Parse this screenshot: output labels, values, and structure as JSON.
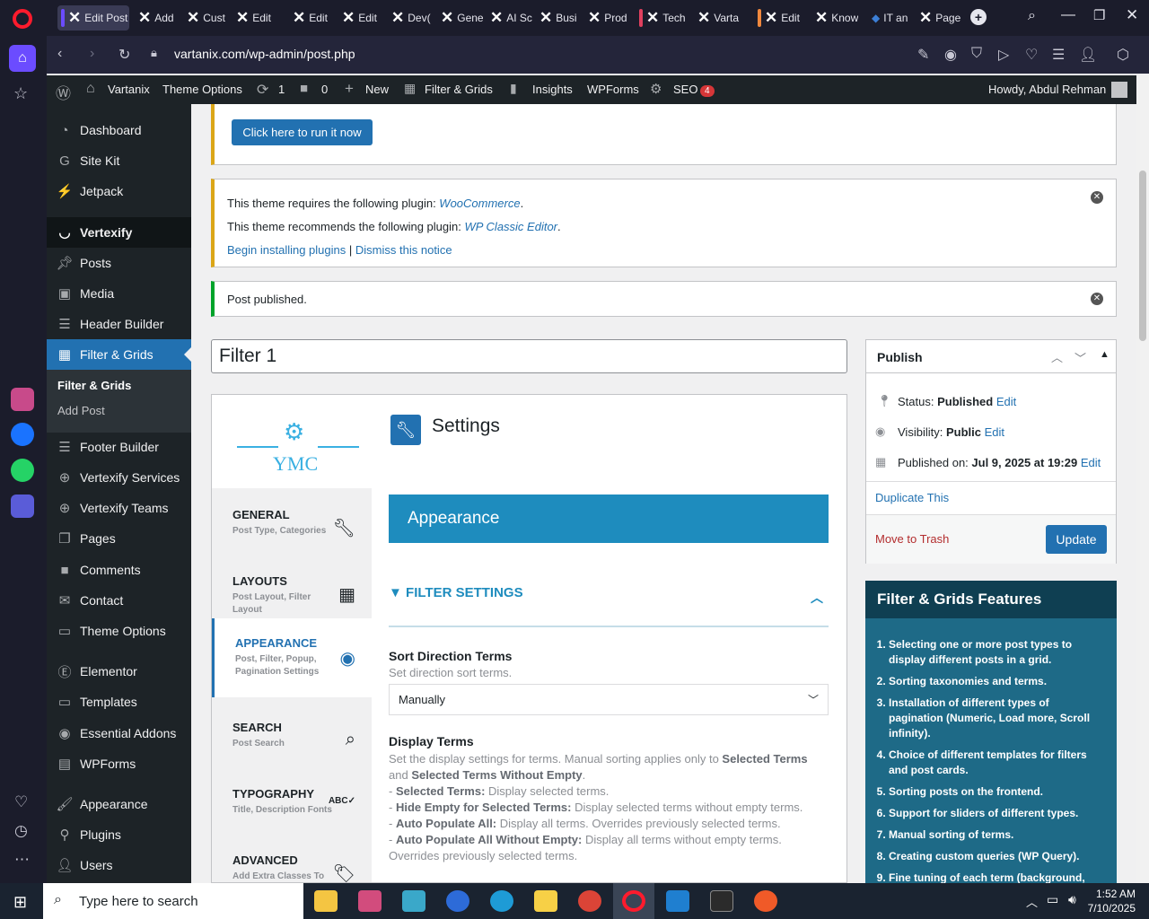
{
  "browser": {
    "tabs": [
      "Edit Post",
      "Add",
      "Cust",
      "Edit",
      "Edit",
      "Edit",
      "Dev(",
      "Gene",
      "AI Sc",
      "Busi",
      "Prod",
      "Tech",
      "Varta",
      "Edit",
      "Know",
      "IT an",
      "Page"
    ],
    "url": "vartanix.com/wp-admin/post.php",
    "accent": "#6b4cff"
  },
  "adminbar": {
    "site": "Vartanix",
    "theme_options": "Theme Options",
    "updates": "1",
    "comments": "0",
    "new": "New",
    "filter_grids": "Filter & Grids",
    "insights": "Insights",
    "wpforms": "WPForms",
    "seo": "SEO",
    "seo_badge": "4",
    "howdy": "Howdy, Abdul Rehman"
  },
  "sidebar": {
    "items": [
      {
        "label": "Dashboard",
        "icon": "dashboard-icon"
      },
      {
        "label": "Site Kit",
        "icon": "google-icon"
      },
      {
        "label": "Jetpack",
        "icon": "jetpack-icon"
      },
      {
        "label": "Vertexify",
        "icon": "smile-icon"
      },
      {
        "label": "Posts",
        "icon": "pin-icon"
      },
      {
        "label": "Media",
        "icon": "media-icon"
      },
      {
        "label": "Header Builder",
        "icon": "list-icon"
      },
      {
        "label": "Filter & Grids",
        "icon": "grid-icon"
      },
      {
        "label": "Footer Builder",
        "icon": "list-icon"
      },
      {
        "label": "Vertexify Services",
        "icon": "plus-circle-icon"
      },
      {
        "label": "Vertexify Teams",
        "icon": "plus-circle-icon"
      },
      {
        "label": "Pages",
        "icon": "pages-icon"
      },
      {
        "label": "Comments",
        "icon": "comment-icon"
      },
      {
        "label": "Contact",
        "icon": "mail-icon"
      },
      {
        "label": "Theme Options",
        "icon": "folder-icon"
      },
      {
        "label": "Elementor",
        "icon": "elementor-icon"
      },
      {
        "label": "Templates",
        "icon": "folder-icon"
      },
      {
        "label": "Essential Addons",
        "icon": "ea-icon"
      },
      {
        "label": "WPForms",
        "icon": "form-icon"
      },
      {
        "label": "Appearance",
        "icon": "brush-icon"
      },
      {
        "label": "Plugins",
        "icon": "plugin-icon"
      },
      {
        "label": "Users",
        "icon": "user-icon"
      }
    ],
    "submenu": [
      "Filter & Grids",
      "Add Post"
    ]
  },
  "notices": {
    "run_button": "Click here to run it now",
    "requires_text": "This theme requires the following plugin: ",
    "requires_link": "WooCommerce",
    "recommends_text": "This theme recommends the following plugin: ",
    "recommends_link": "WP Classic Editor",
    "begin_installing": "Begin installing plugins",
    "separator": "|",
    "dismiss": "Dismiss this notice",
    "published": "Post published."
  },
  "post": {
    "title": "Filter 1"
  },
  "plugin": {
    "logo_text": "YMC",
    "nav": [
      {
        "title": "GENERAL",
        "sub": "Post Type, Categories",
        "icon": "wrench-icon"
      },
      {
        "title": "LAYOUTS",
        "sub": "Post Layout, Filter Layout",
        "icon": "table-icon"
      },
      {
        "title": "APPEARANCE",
        "sub": "Post, Filter, Popup, Pagination Settings",
        "icon": "eye-icon"
      },
      {
        "title": "SEARCH",
        "sub": "Post Search",
        "icon": "search-icon"
      },
      {
        "title": "TYPOGRAPHY",
        "sub": "Title, Description Fonts",
        "icon": "abc-icon"
      },
      {
        "title": "ADVANCED",
        "sub": "Add Extra Classes To Post",
        "icon": "tag-icon"
      }
    ],
    "settings_title": "Settings",
    "section_banner": "Appearance",
    "filter_settings": "FILTER SETTINGS",
    "sort_label": "Sort Direction Terms",
    "sort_desc": "Set direction sort terms.",
    "sort_value": "Manually",
    "display_label": "Display Terms",
    "display_desc_1": "Set the display settings for terms. Manual sorting applies only to ",
    "display_desc_b1": "Selected Terms",
    "display_desc_2": " and ",
    "display_desc_b2": "Selected Terms Without Empty",
    "display_desc_3": ".",
    "opt1_b": "Selected Terms:",
    "opt1": " Display selected terms.",
    "opt2_b": "Hide Empty for Selected Terms:",
    "opt2": " Display selected terms without empty terms.",
    "opt3_b": "Auto Populate All:",
    "opt3": " Display all terms. Overrides previously selected terms.",
    "opt4_b": "Auto Populate All Without Empty:",
    "opt4": " Display all terms without empty terms. Overrides previously selected terms."
  },
  "publish": {
    "title": "Publish",
    "status_label": "Status: ",
    "status": "Published",
    "visibility_label": "Visibility: ",
    "visibility": "Public",
    "published_label": "Published on: ",
    "published_date": "Jul 9, 2025 at 19:29",
    "edit": "Edit",
    "duplicate": "Duplicate This",
    "trash": "Move to Trash",
    "update": "Update"
  },
  "features": {
    "title": "Filter & Grids Features",
    "items": [
      "Selecting one or more post types to display different posts in a grid.",
      "Sorting taxonomies and terms.",
      "Installation of different types of pagination (Numeric, Load more, Scroll infinity).",
      "Choice of different templates for filters and post cards.",
      "Sorting posts on the frontend.",
      "Support for sliders of different types.",
      "Manual sorting of terms.",
      "Creating custom queries (WP Query).",
      "Fine tuning of each term (background, color, icons, etc.)."
    ]
  },
  "taskbar": {
    "search_placeholder": "Type here to search",
    "time": "1:52 AM",
    "date": "7/10/2025"
  }
}
